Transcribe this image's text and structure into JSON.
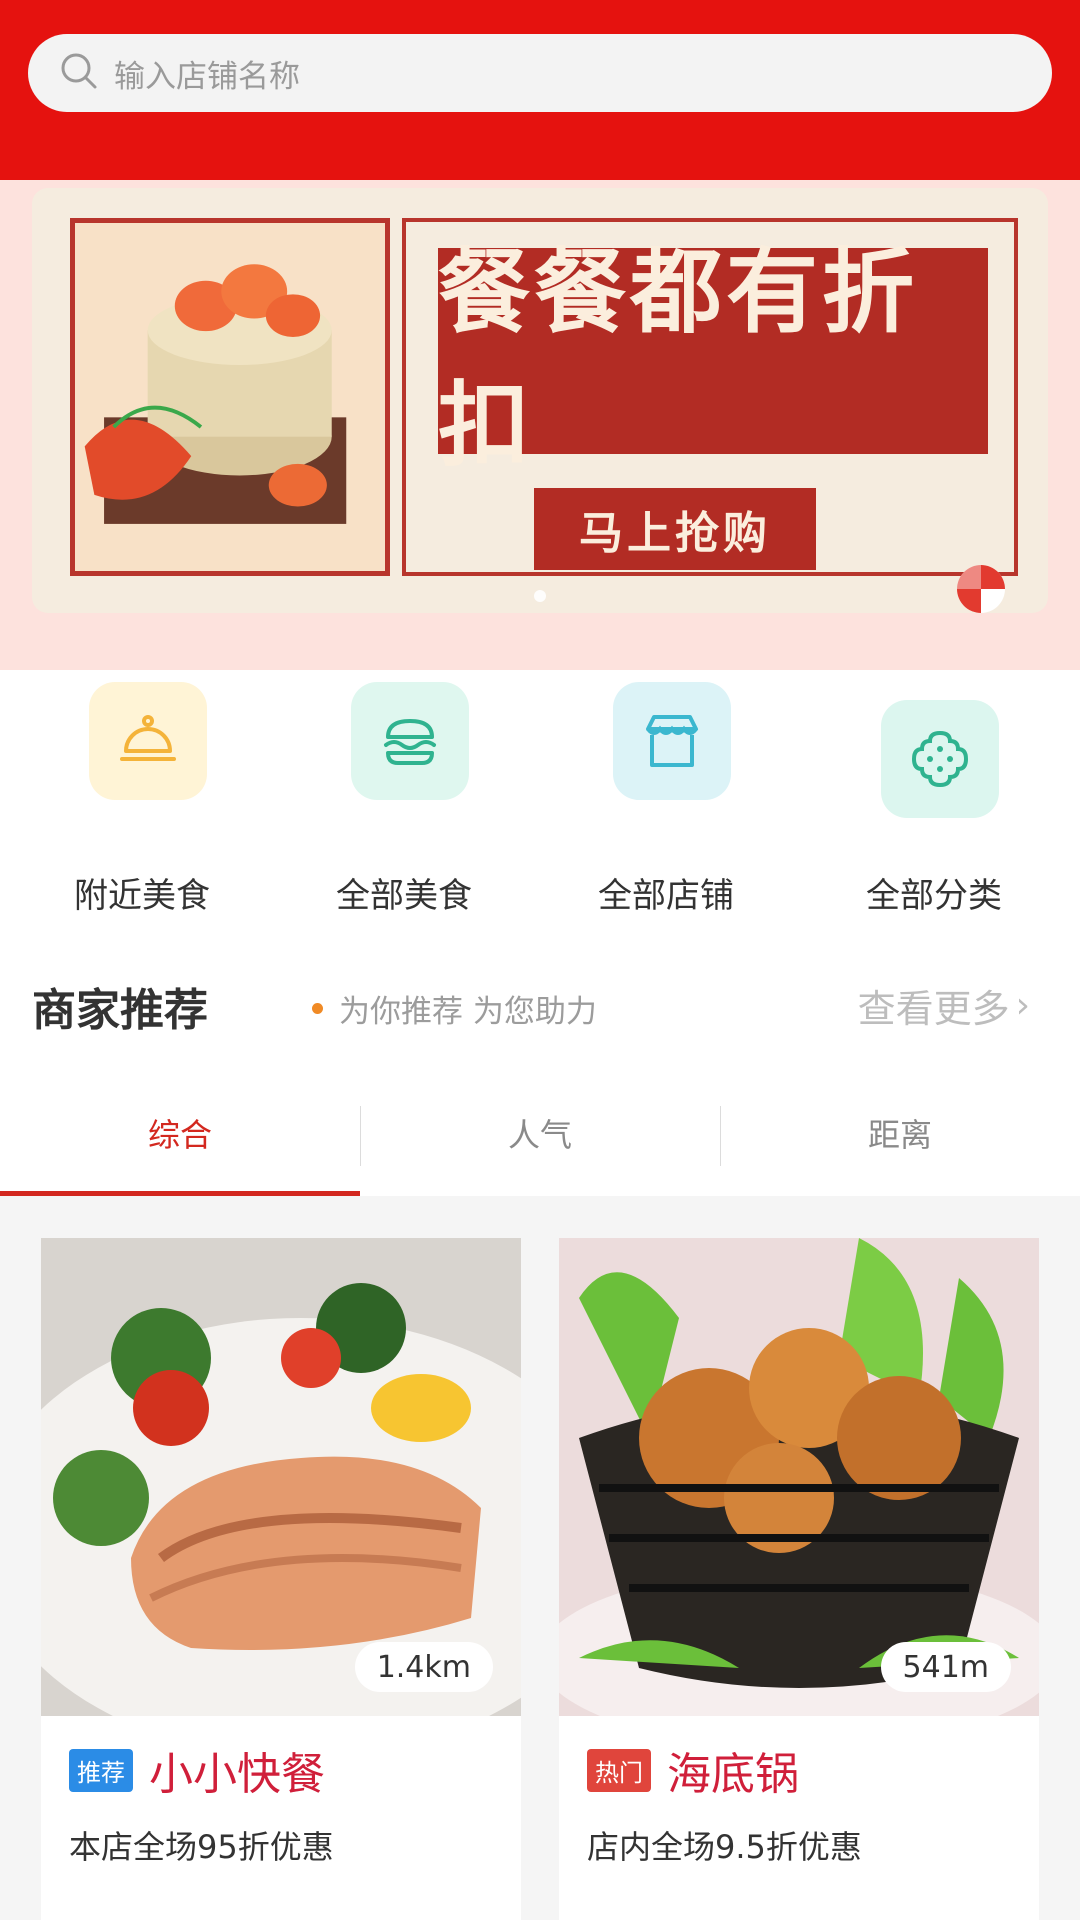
{
  "search": {
    "placeholder": "输入店铺名称",
    "icon": "search-icon"
  },
  "banner": {
    "headline": "餐餐都有折扣",
    "cta": "马上抢购"
  },
  "categories": [
    {
      "label": "附近美食",
      "icon": "service-bell-icon",
      "bg": "#fff4d6",
      "color": "#f4b33a"
    },
    {
      "label": "全部美食",
      "icon": "burger-icon",
      "bg": "#dff7ef",
      "color": "#2fb38f"
    },
    {
      "label": "全部店铺",
      "icon": "storefront-icon",
      "bg": "#dcf3f7",
      "color": "#3bb7cf"
    },
    {
      "label": "全部分类",
      "icon": "cookie-icon",
      "bg": "#dcf6ef",
      "color": "#2fb38f"
    }
  ],
  "recommend": {
    "title": "商家推荐",
    "subtitle": "为你推荐 为您助力",
    "more": "查看更多"
  },
  "tabs": [
    {
      "label": "综合",
      "active": true
    },
    {
      "label": "人气",
      "active": false
    },
    {
      "label": "距离",
      "active": false
    }
  ],
  "shops": [
    {
      "distance": "1.4km",
      "tag": "推荐",
      "tag_color": "#2b8ce6",
      "name": "小小快餐",
      "promo": "本店全场95折优惠",
      "image": "salmon-dish-photo"
    },
    {
      "distance": "541m",
      "tag": "热门",
      "tag_color": "#e0453c",
      "name": "海底锅",
      "promo": "店内全场9.5折优惠",
      "image": "fried-chicken-photo"
    }
  ],
  "colors": {
    "primary": "#e5120f",
    "accent": "#d3281f",
    "shop_name": "#d01f3a"
  }
}
